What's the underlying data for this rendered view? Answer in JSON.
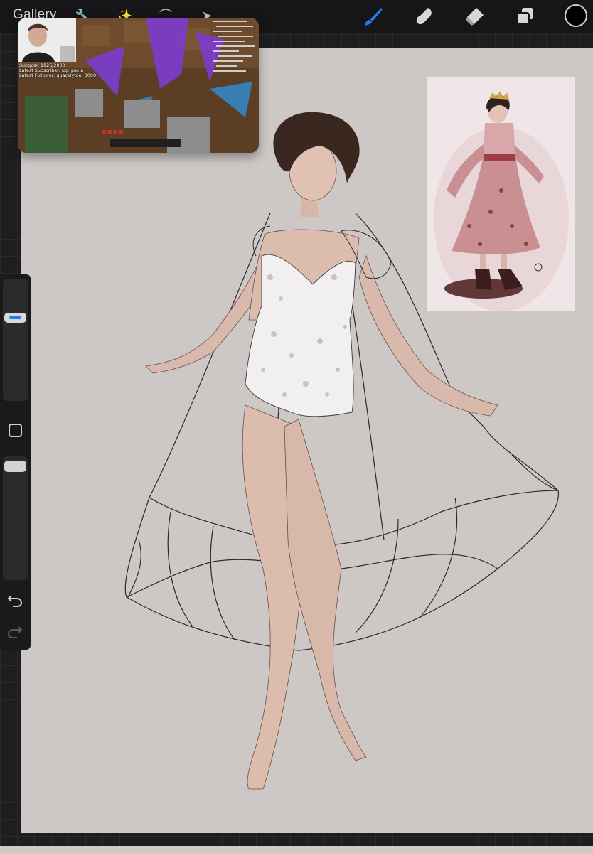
{
  "toolbar": {
    "gallery_label": "Gallery",
    "left_tools": [
      "wrench-icon",
      "magic-wand-icon",
      "selection-icon",
      "transform-arrow-icon"
    ],
    "right_tools": [
      "brush-icon",
      "smudge-icon",
      "eraser-icon",
      "layers-icon"
    ],
    "active_tool": "brush-icon",
    "current_color": "#000000",
    "accent_color": "#1f7cf2"
  },
  "sidebar": {
    "size_slider_level": 0.3,
    "opacity_slider_level": 0.05,
    "buttons": [
      "modify-icon",
      "undo-icon",
      "redo-icon"
    ]
  },
  "stream_overlay": {
    "subgoal": "Subgoal: 1926/2000",
    "latest_subscriber": "Latest Subscriber: ugi_pacia",
    "latest_follower": "Latest Follower: quacklytoo: 3000"
  },
  "canvas": {
    "background_color": "#cdc7c6"
  }
}
